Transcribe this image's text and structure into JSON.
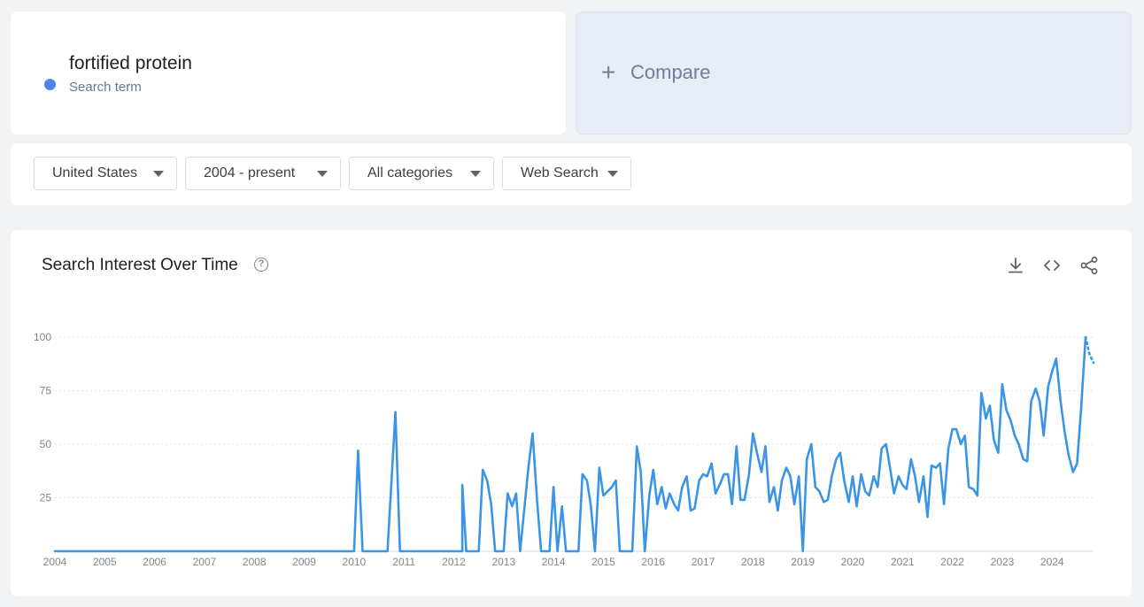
{
  "search_term": {
    "label": "fortified protein",
    "sublabel": "Search term",
    "color": "#4f84ec"
  },
  "compare": {
    "label": "Compare",
    "plus": "+"
  },
  "filters": [
    {
      "label": "United States"
    },
    {
      "label": "2004 - present"
    },
    {
      "label": "All categories"
    },
    {
      "label": "Web Search"
    }
  ],
  "chart_section": {
    "title": "Search Interest Over Time",
    "help_icon": "help-circle-icon",
    "actions": [
      "download-icon",
      "embed-code-icon",
      "share-icon"
    ]
  },
  "chart_data": {
    "type": "line",
    "title": "Search Interest Over Time",
    "xlabel": "",
    "ylabel": "",
    "ylim": [
      0,
      100
    ],
    "yticks": [
      "100",
      "75",
      "50",
      "25"
    ],
    "xticks": [
      "2004",
      "2005",
      "2006",
      "2007",
      "2008",
      "2009",
      "2010",
      "2011",
      "2012",
      "2013",
      "2014",
      "2015",
      "2016",
      "2017",
      "2018",
      "2019",
      "2020",
      "2021",
      "2022",
      "2023",
      "2024"
    ],
    "grid": true,
    "line_color": "#3b95e6",
    "series": [
      {
        "name": "fortified protein",
        "points": [
          [
            2004.0,
            0
          ],
          [
            2010.0,
            0
          ],
          [
            2010.08,
            47
          ],
          [
            2010.17,
            0
          ],
          [
            2010.67,
            0
          ],
          [
            2010.83,
            65
          ],
          [
            2010.92,
            0
          ],
          [
            2012.17,
            0
          ],
          [
            2012.17,
            31
          ],
          [
            2012.25,
            0
          ],
          [
            2012.5,
            0
          ],
          [
            2012.58,
            38
          ],
          [
            2012.67,
            33
          ],
          [
            2012.75,
            22
          ],
          [
            2012.83,
            0
          ],
          [
            2013.0,
            0
          ],
          [
            2013.08,
            27
          ],
          [
            2013.17,
            21
          ],
          [
            2013.25,
            27
          ],
          [
            2013.33,
            0
          ],
          [
            2013.5,
            40
          ],
          [
            2013.58,
            55
          ],
          [
            2013.67,
            24
          ],
          [
            2013.75,
            0
          ],
          [
            2013.92,
            0
          ],
          [
            2014.0,
            30
          ],
          [
            2014.08,
            0
          ],
          [
            2014.17,
            21
          ],
          [
            2014.25,
            0
          ],
          [
            2014.5,
            0
          ],
          [
            2014.58,
            36
          ],
          [
            2014.67,
            33
          ],
          [
            2014.75,
            21
          ],
          [
            2014.83,
            0
          ],
          [
            2014.92,
            39
          ],
          [
            2015.0,
            26
          ],
          [
            2015.17,
            30
          ],
          [
            2015.25,
            33
          ],
          [
            2015.33,
            0
          ],
          [
            2015.58,
            0
          ],
          [
            2015.67,
            49
          ],
          [
            2015.75,
            37
          ],
          [
            2015.83,
            0
          ],
          [
            2015.92,
            26
          ],
          [
            2016.0,
            38
          ],
          [
            2016.08,
            22
          ],
          [
            2016.17,
            30
          ],
          [
            2016.25,
            20
          ],
          [
            2016.33,
            27
          ],
          [
            2016.42,
            22
          ],
          [
            2016.5,
            19
          ],
          [
            2016.58,
            30
          ],
          [
            2016.67,
            35
          ],
          [
            2016.75,
            19
          ],
          [
            2016.83,
            20
          ],
          [
            2016.92,
            33
          ],
          [
            2017.0,
            36
          ],
          [
            2017.08,
            35
          ],
          [
            2017.17,
            41
          ],
          [
            2017.25,
            27
          ],
          [
            2017.33,
            31
          ],
          [
            2017.42,
            36
          ],
          [
            2017.5,
            36
          ],
          [
            2017.58,
            22
          ],
          [
            2017.67,
            49
          ],
          [
            2017.75,
            24
          ],
          [
            2017.83,
            24
          ],
          [
            2017.92,
            36
          ],
          [
            2018.0,
            55
          ],
          [
            2018.08,
            46
          ],
          [
            2018.17,
            37
          ],
          [
            2018.25,
            49
          ],
          [
            2018.33,
            23
          ],
          [
            2018.42,
            30
          ],
          [
            2018.5,
            19
          ],
          [
            2018.58,
            33
          ],
          [
            2018.67,
            39
          ],
          [
            2018.75,
            35
          ],
          [
            2018.83,
            22
          ],
          [
            2018.92,
            35
          ],
          [
            2019.0,
            0
          ],
          [
            2019.08,
            43
          ],
          [
            2019.17,
            50
          ],
          [
            2019.25,
            30
          ],
          [
            2019.33,
            28
          ],
          [
            2019.42,
            23
          ],
          [
            2019.5,
            24
          ],
          [
            2019.58,
            35
          ],
          [
            2019.67,
            43
          ],
          [
            2019.75,
            46
          ],
          [
            2019.83,
            33
          ],
          [
            2019.92,
            23
          ],
          [
            2020.0,
            35
          ],
          [
            2020.08,
            21
          ],
          [
            2020.17,
            36
          ],
          [
            2020.25,
            28
          ],
          [
            2020.33,
            26
          ],
          [
            2020.42,
            35
          ],
          [
            2020.5,
            30
          ],
          [
            2020.58,
            48
          ],
          [
            2020.67,
            50
          ],
          [
            2020.75,
            39
          ],
          [
            2020.83,
            27
          ],
          [
            2020.92,
            35
          ],
          [
            2021.0,
            31
          ],
          [
            2021.08,
            29
          ],
          [
            2021.17,
            43
          ],
          [
            2021.25,
            35
          ],
          [
            2021.33,
            23
          ],
          [
            2021.42,
            35
          ],
          [
            2021.5,
            16
          ],
          [
            2021.58,
            40
          ],
          [
            2021.67,
            39
          ],
          [
            2021.75,
            41
          ],
          [
            2021.83,
            22
          ],
          [
            2021.92,
            48
          ],
          [
            2022.0,
            57
          ],
          [
            2022.08,
            57
          ],
          [
            2022.17,
            50
          ],
          [
            2022.25,
            54
          ],
          [
            2022.33,
            30
          ],
          [
            2022.42,
            29
          ],
          [
            2022.5,
            26
          ],
          [
            2022.58,
            74
          ],
          [
            2022.67,
            62
          ],
          [
            2022.75,
            68
          ],
          [
            2022.83,
            52
          ],
          [
            2022.92,
            46
          ],
          [
            2023.0,
            78
          ],
          [
            2023.08,
            66
          ],
          [
            2023.17,
            61
          ],
          [
            2023.25,
            54
          ],
          [
            2023.33,
            50
          ],
          [
            2023.42,
            43
          ],
          [
            2023.5,
            42
          ],
          [
            2023.58,
            70
          ],
          [
            2023.67,
            76
          ],
          [
            2023.75,
            70
          ],
          [
            2023.83,
            54
          ],
          [
            2023.92,
            77
          ],
          [
            2024.0,
            84
          ],
          [
            2024.08,
            90
          ],
          [
            2024.17,
            70
          ],
          [
            2024.25,
            56
          ],
          [
            2024.33,
            45
          ],
          [
            2024.42,
            37
          ],
          [
            2024.5,
            41
          ],
          [
            2024.58,
            66
          ],
          [
            2024.67,
            100
          ]
        ],
        "partial_points": [
          [
            2024.67,
            100
          ],
          [
            2024.75,
            92
          ],
          [
            2024.83,
            88
          ]
        ]
      }
    ]
  }
}
